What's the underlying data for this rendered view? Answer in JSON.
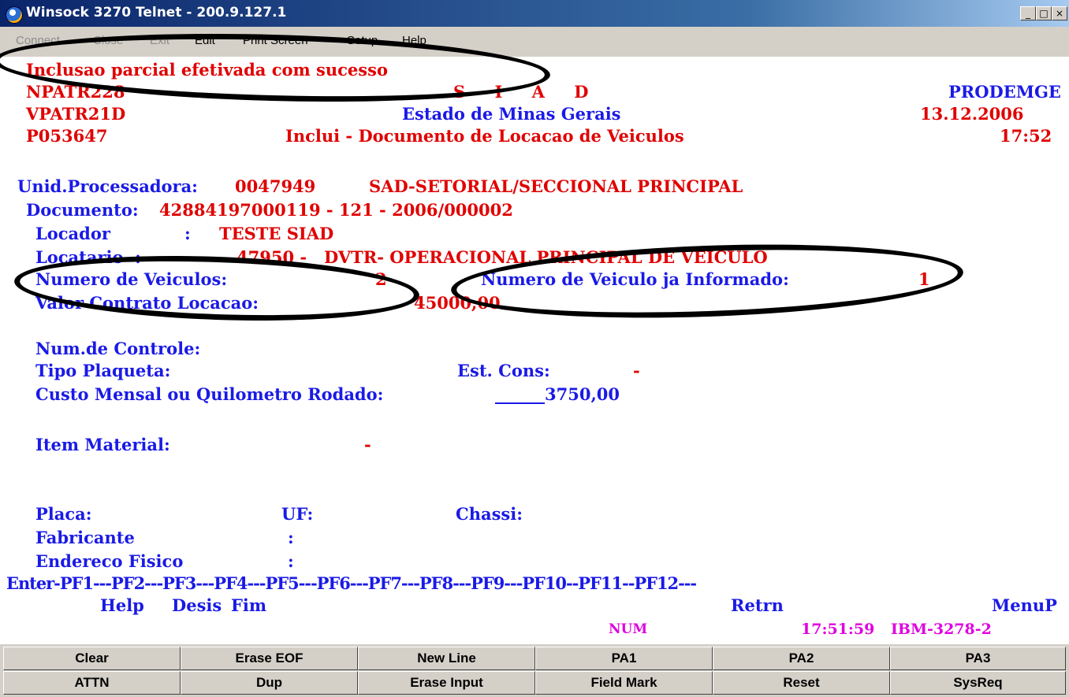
{
  "window": {
    "title": "Winsock 3270 Telnet - 200.9.127.1",
    "buttons": {
      "minimize": "_",
      "maximize": "□",
      "close": "×"
    }
  },
  "menu": [
    "Connect",
    "Close",
    "Exit",
    "Edit",
    "Print Screen",
    "Setup",
    "Help"
  ],
  "screen": {
    "message": "Inclusao parcial efetivada com sucesso",
    "header": {
      "program": "NPATR228",
      "system": "S I A D",
      "org": "PRODEMGE",
      "screen_id": "VPATR21D",
      "state": "Estado de Minas Gerais",
      "date": "13.12.2006",
      "user": "P053647",
      "function": "Inclui - Documento de Locacao de Veiculos",
      "time": "17:52"
    },
    "fields": {
      "unid_label": "Unid.Processadora:",
      "unid_code": "0047949",
      "unid_name": "SAD-SETORIAL/SECCIONAL PRINCIPAL",
      "documento_label": "Documento:",
      "documento_value": "42884197000119 - 121 - 2006/000002",
      "locador_label": "Locador",
      "locador_sep": ":",
      "locador_value": "TESTE SIAD",
      "locatario_label": "Locatario  :",
      "locatario_value": "47950 -   DVTR- OPERACIONAL PRINCIPAL DE VEICULO",
      "num_veiculos_label": "Numero de Veiculos:",
      "num_veiculos_value": "2",
      "num_informado_label": "Numero de Veiculo ja Informado:",
      "num_informado_value": "1",
      "valor_label": "Valor Contrato Locacao:",
      "valor_value": "45000,00",
      "controle_label": "Num.de Controle:",
      "plaqueta_label": "Tipo Plaqueta:",
      "est_cons_label": "Est. Cons:",
      "est_cons_value": "-",
      "custo_label": "Custo Mensal ou Quilometro Rodado:",
      "custo_value": "______3750,00",
      "item_label": "Item Material:",
      "item_value": "-",
      "placa_label": "Placa:",
      "uf_label": "UF:",
      "chassi_label": "Chassi:",
      "fabricante_label": "Fabricante",
      "fabricante_sep": ":",
      "endereco_label": "Endereco Fisico",
      "endereco_sep": ":"
    },
    "pf_line": "Enter-PF1---PF2---PF3---PF4---PF5---PF6---PF7---PF8---PF9---PF10--PF11--PF12---",
    "pf_labels": {
      "help": "Help",
      "desis": "Desis",
      "fim": "Fim",
      "retrn": "Retrn",
      "menup": "MenuP"
    },
    "status": {
      "num": "NUM",
      "clock": "17:51:59",
      "terminal": "IBM-3278-2"
    }
  },
  "keypad": {
    "row1": [
      "Clear",
      "Erase EOF",
      "New Line",
      "PA1",
      "PA2",
      "PA3"
    ],
    "row2": [
      "ATTN",
      "Dup",
      "Erase Input",
      "Field Mark",
      "Reset",
      "SysReq"
    ]
  },
  "colors": {
    "field_red": "#e00000",
    "label_blue": "#1a1ae6",
    "status_magenta": "#e000e0",
    "title_bar": "#0a246a"
  }
}
